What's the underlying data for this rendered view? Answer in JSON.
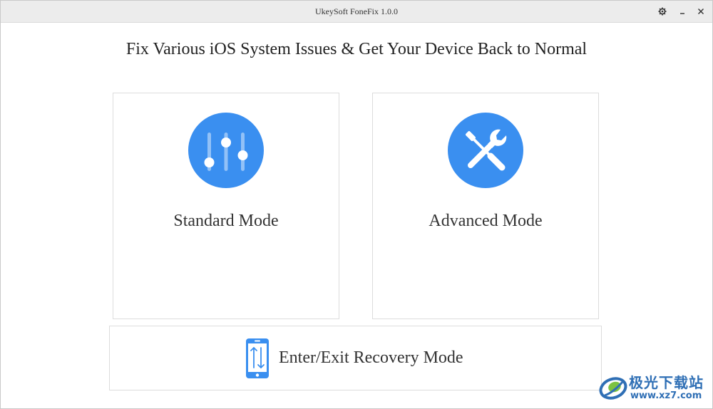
{
  "window": {
    "title": "UkeySoft FoneFix 1.0.0",
    "controls": {
      "settings_icon": "gear-icon",
      "minimize_icon": "minimize-icon",
      "close_icon": "close-icon"
    }
  },
  "main": {
    "headline": "Fix Various iOS System Issues & Get Your Device Back to Normal",
    "modes": [
      {
        "label": "Standard Mode",
        "icon": "sliders-icon"
      },
      {
        "label": "Advanced Mode",
        "icon": "tools-icon"
      }
    ],
    "recovery": {
      "label": "Enter/Exit Recovery Mode",
      "icon": "phone-arrows-icon"
    }
  },
  "watermark": {
    "text_cn": "极光下载站",
    "url": "www.xz7.com"
  },
  "colors": {
    "accent": "#3a8ff0",
    "titlebar": "#ececec",
    "border": "#dcdcdc",
    "text": "#333333",
    "watermark": "#2f6fb5"
  }
}
